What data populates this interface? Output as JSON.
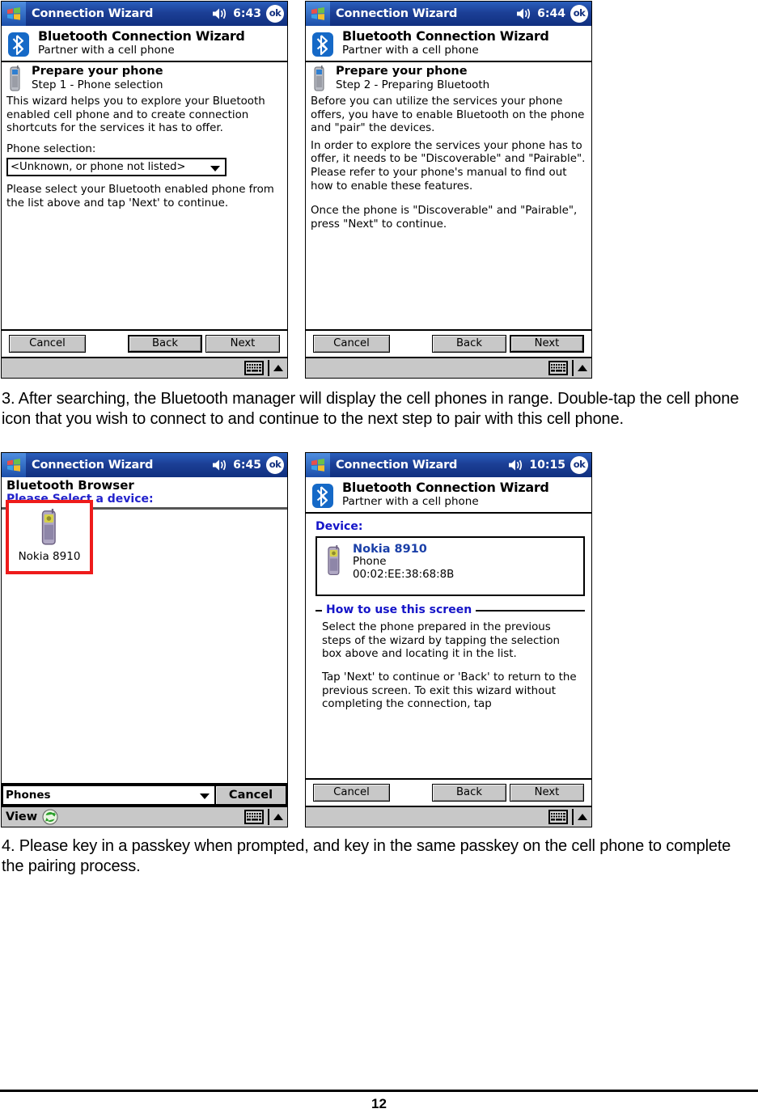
{
  "document": {
    "page_number": "12",
    "paragraphs": [
      "3. After searching, the Bluetooth manager will display the cell phones in range. Double-tap the cell phone icon that you wish to connect to and continue to the next step to pair with this cell phone.",
      "4. Please key in a passkey when prompted, and   key in the same passkey on the cell phone to complete the pairing process."
    ]
  },
  "colors": {
    "titlebar_blue": "#13307e",
    "bluetooth_blue": "#1569c7",
    "selection_red": "#ee1b1b",
    "link_blue": "#1414c8",
    "button_gray": "#c8c8c8"
  },
  "screens": {
    "step1": {
      "taskbar": {
        "title": "Connection Wizard",
        "time": "6:43",
        "ok_label": "ok",
        "speaker_icon": "speaker-icon",
        "start_icon": "windows-start-icon"
      },
      "header": {
        "icon": "bluetooth-icon",
        "title": "Bluetooth Connection Wizard",
        "subtitle": "Partner with a cell phone"
      },
      "step": {
        "icon": "cell-phone-icon",
        "title": "Prepare your phone",
        "subtitle": "Step 1 - Phone selection"
      },
      "body_paragraph": "This wizard helps you to explore your Bluetooth enabled cell phone and to create connection shortcuts for the services it has to offer.",
      "field_label": "Phone selection:",
      "combo_value": "<Unknown, or phone not listed>",
      "hint_paragraph": "Please select your Bluetooth enabled phone from the list above and tap 'Next' to continue.",
      "buttons": {
        "cancel": "Cancel",
        "back": "Back",
        "next": "Next",
        "focused": "back"
      },
      "taskbar_bottom": {
        "keyboard_icon": "keyboard-icon",
        "arrow_icon": "chevron-up-icon"
      }
    },
    "step2": {
      "taskbar": {
        "title": "Connection Wizard",
        "time": "6:44",
        "ok_label": "ok",
        "speaker_icon": "speaker-icon",
        "start_icon": "windows-start-icon"
      },
      "header": {
        "icon": "bluetooth-icon",
        "title": "Bluetooth Connection Wizard",
        "subtitle": "Partner with a cell phone"
      },
      "step": {
        "icon": "cell-phone-icon",
        "title": "Prepare your phone",
        "subtitle": "Step 2 - Preparing Bluetooth"
      },
      "paragraph1": "Before you can utilize the services your phone offers, you have to enable Bluetooth on the phone and \"pair\" the devices.",
      "paragraph2": "In order to explore the services your phone has to offer, it needs to be \"Discoverable\" and \"Pairable\". Please refer to your phone's manual to find out how to enable these features.",
      "paragraph3": "Once the phone is \"Discoverable\" and \"Pairable\", press \"Next\" to continue.",
      "buttons": {
        "cancel": "Cancel",
        "back": "Back",
        "next": "Next",
        "focused": "next"
      },
      "taskbar_bottom": {
        "keyboard_icon": "keyboard-icon",
        "arrow_icon": "chevron-up-icon"
      }
    },
    "browser": {
      "taskbar": {
        "title": "Connection Wizard",
        "time": "6:45",
        "ok_label": "ok",
        "speaker_icon": "speaker-icon",
        "start_icon": "windows-start-icon"
      },
      "title": "Bluetooth Browser",
      "prompt": "Please Select a device:",
      "device_tile": {
        "icon": "cell-phone-icon",
        "label": "Nokia 8910",
        "selected": true
      },
      "filter_combo_value": "Phones",
      "cancel_label": "Cancel",
      "view_label": "View",
      "view_icon": "refresh-icon",
      "taskbar_bottom": {
        "keyboard_icon": "keyboard-icon",
        "arrow_icon": "chevron-up-icon"
      }
    },
    "device": {
      "taskbar": {
        "title": "Connection Wizard",
        "time": "10:15",
        "ok_label": "ok",
        "speaker_icon": "speaker-icon",
        "start_icon": "windows-start-icon"
      },
      "header": {
        "icon": "bluetooth-icon",
        "title": "Bluetooth Connection Wizard",
        "subtitle": "Partner with a cell phone"
      },
      "device_label": "Device:",
      "device": {
        "icon": "cell-phone-icon",
        "name": "Nokia 8910",
        "type": "Phone",
        "address": "00:02:EE:38:68:8B"
      },
      "group_legend": "How to use this screen",
      "group_paragraph1": "Select the phone prepared in the previous steps of the wizard by tapping the selection box above and locating it in the list.",
      "group_paragraph2": "Tap 'Next' to continue or 'Back' to return to the previous screen. To exit this wizard without completing the connection, tap",
      "buttons": {
        "cancel": "Cancel",
        "back": "Back",
        "next": "Next",
        "focused": "none"
      },
      "taskbar_bottom": {
        "keyboard_icon": "keyboard-icon",
        "arrow_icon": "chevron-up-icon"
      }
    }
  }
}
